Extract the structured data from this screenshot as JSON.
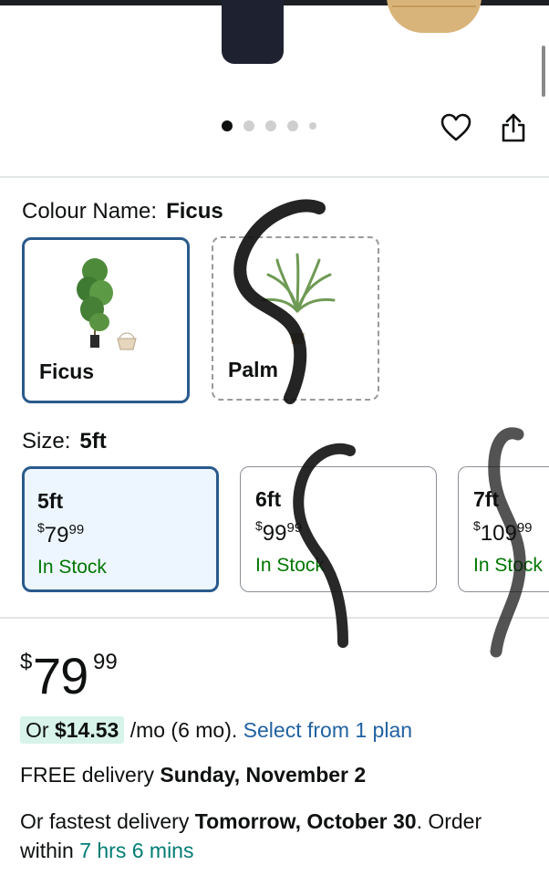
{
  "gallery": {
    "dots_count": 5,
    "active_dot": 0
  },
  "colour": {
    "label": "Colour Name:",
    "selected": "Ficus",
    "options": [
      {
        "name": "Ficus",
        "selected": true
      },
      {
        "name": "Palm",
        "selected": false
      }
    ]
  },
  "size": {
    "label": "Size:",
    "selected": "5ft",
    "options": [
      {
        "size": "5ft",
        "price_symbol": "$",
        "price_whole": "79",
        "price_fraction": "99",
        "stock": "In Stock",
        "selected": true
      },
      {
        "size": "6ft",
        "price_symbol": "$",
        "price_whole": "99",
        "price_fraction": "99",
        "stock": "In Stock",
        "selected": false
      },
      {
        "size": "7ft",
        "price_symbol": "$",
        "price_whole": "109",
        "price_fraction": "99",
        "stock": "In Stock",
        "selected": false
      }
    ]
  },
  "price": {
    "symbol": "$",
    "whole": "79",
    "fraction": "99"
  },
  "financing": {
    "prefix": "Or",
    "amount": "$14.53",
    "term": "/mo (6 mo).",
    "link": "Select from 1 plan"
  },
  "delivery": {
    "free_prefix": "FREE delivery",
    "free_date": "Sunday, November 2",
    "fast_prefix": "Or fastest delivery",
    "fast_date": "Tomorrow, October 30",
    "order_within_prefix": ". Order within",
    "countdown": "7 hrs 6 mins"
  },
  "colors": {
    "accent_blue": "#2a5a8c",
    "selected_bg": "#edf6ff",
    "in_stock_green": "#007600",
    "link_blue": "#2162a1",
    "countdown_teal": "#007c73",
    "financing_highlight": "#d8f3ea"
  },
  "icons": {
    "wishlist": "heart-icon",
    "share": "share-icon"
  }
}
